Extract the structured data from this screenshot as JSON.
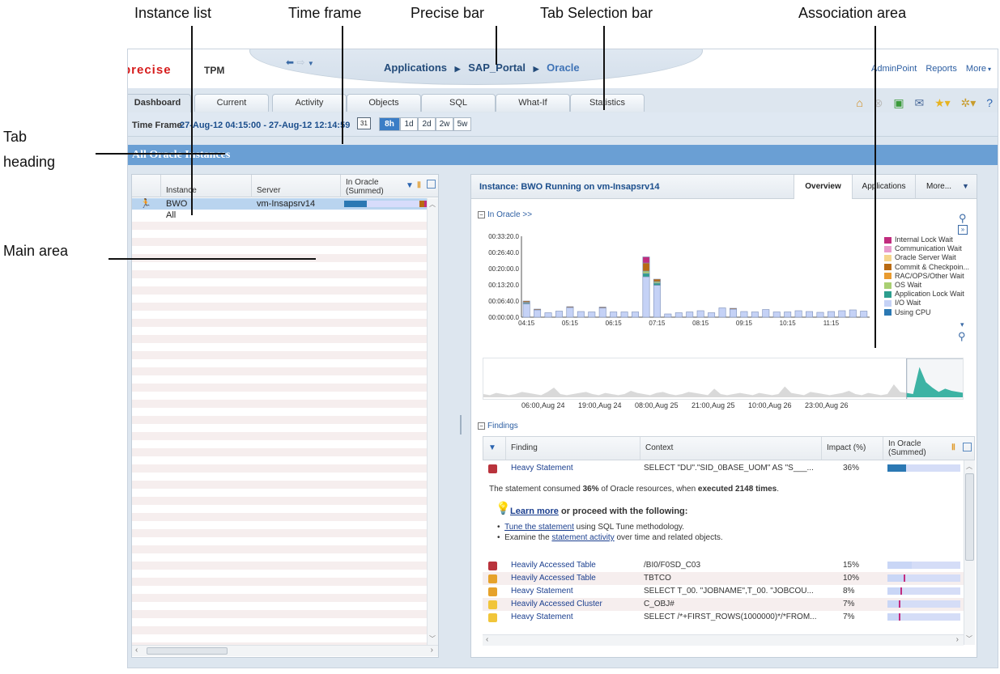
{
  "callouts": {
    "instance_list": "Instance list",
    "time_frame": "Time frame",
    "precise_bar": "Precise bar",
    "tab_selection_bar": "Tab Selection bar",
    "association_area": "Association area",
    "tab_heading_line1": "Tab",
    "tab_heading_line2": "heading",
    "main_area": "Main area"
  },
  "app": {
    "logo": "precise",
    "product": "TPM",
    "breadcrumb": {
      "applications": "Applications",
      "sap_portal": "SAP_Portal",
      "current": "Oracle"
    },
    "toplinks": {
      "adminpoint": "AdminPoint",
      "reports": "Reports",
      "more": "More"
    },
    "tabs": [
      "Dashboard",
      "Current",
      "Activity",
      "Objects",
      "SQL",
      "What-If",
      "Statistics"
    ],
    "active_tab": "Dashboard",
    "toolbar_icons": [
      "home-icon",
      "stop-icon",
      "save-icon",
      "mail-icon",
      "star-icon",
      "gear-icon",
      "help-icon"
    ]
  },
  "timeframe": {
    "label": "Time Frame:",
    "value": "27-Aug-12 04:15:00 - 27-Aug-12 12:14:59",
    "calendar": "31",
    "buttons": [
      "8h",
      "1d",
      "2d",
      "2w",
      "5w"
    ],
    "active": "8h"
  },
  "heading": "All Oracle Instances",
  "instance_table": {
    "headers": {
      "instance": "Instance",
      "server": "Server",
      "inoracle": "In Oracle (Summed)"
    },
    "rows": [
      {
        "instance": "BWO",
        "server": "vm-Insapsrv14"
      },
      {
        "instance": "All",
        "server": ""
      }
    ]
  },
  "association": {
    "title": "Instance: BWO Running on vm-Insapsrv14",
    "tabs": {
      "overview": "Overview",
      "applications": "Applications",
      "more": "More..."
    },
    "inoracle_label": "In Oracle >>",
    "findings_label": "Findings"
  },
  "chart_data": [
    {
      "type": "bar",
      "title": "",
      "categories": [
        "04:15",
        "04:30",
        "04:45",
        "05:00",
        "05:15",
        "05:30",
        "05:45",
        "06:00",
        "06:15",
        "06:30",
        "06:45",
        "07:00",
        "07:15",
        "07:30",
        "07:45",
        "08:00",
        "08:15",
        "08:30",
        "08:45",
        "09:00",
        "09:15",
        "09:30",
        "09:45",
        "10:00",
        "10:15",
        "10:30",
        "10:45",
        "11:00",
        "11:15",
        "11:30",
        "11:45",
        "12:00"
      ],
      "ytick_labels": [
        "00:00:00.0",
        "00:06:40.0",
        "00:13:20.0",
        "00:20:00.0",
        "00:26:40.0",
        "00:33:20.0"
      ],
      "xtick_labels": [
        "04:15",
        "05:15",
        "06:15",
        "07:15",
        "08:15",
        "09:15",
        "10:15",
        "11:15"
      ],
      "ylim_seconds": [
        0,
        2000
      ],
      "series": [
        {
          "name": "I/O Wait",
          "values": [
            330,
            180,
            110,
            150,
            240,
            140,
            130,
            230,
            130,
            130,
            130,
            1000,
            790,
            80,
            110,
            130,
            160,
            110,
            230,
            200,
            140,
            130,
            190,
            130,
            130,
            160,
            140,
            120,
            140,
            160,
            180,
            150
          ]
        },
        {
          "name": "Application Lock Wait",
          "values": [
            20,
            0,
            0,
            0,
            0,
            0,
            0,
            0,
            0,
            0,
            0,
            80,
            50,
            0,
            0,
            0,
            0,
            0,
            0,
            0,
            0,
            0,
            0,
            0,
            0,
            0,
            0,
            0,
            0,
            0,
            0,
            0
          ]
        },
        {
          "name": "OS Wait",
          "values": [
            20,
            0,
            0,
            0,
            0,
            0,
            0,
            0,
            0,
            0,
            0,
            60,
            40,
            0,
            0,
            0,
            0,
            0,
            0,
            0,
            0,
            0,
            0,
            0,
            0,
            0,
            0,
            0,
            0,
            0,
            0,
            0
          ]
        },
        {
          "name": "Commit & Checkpoin...",
          "values": [
            30,
            20,
            0,
            0,
            20,
            0,
            0,
            20,
            0,
            0,
            0,
            200,
            60,
            0,
            0,
            0,
            0,
            0,
            0,
            20,
            0,
            0,
            0,
            0,
            0,
            0,
            0,
            0,
            0,
            0,
            0,
            0
          ]
        },
        {
          "name": "Internal Lock Wait",
          "values": [
            0,
            0,
            0,
            0,
            0,
            0,
            0,
            0,
            0,
            0,
            0,
            150,
            0,
            0,
            0,
            0,
            0,
            0,
            0,
            0,
            0,
            0,
            0,
            0,
            0,
            0,
            0,
            0,
            0,
            0,
            0,
            0
          ]
        },
        {
          "name": "Oracle Server Wait",
          "values": [
            0,
            0,
            0,
            0,
            0,
            0,
            0,
            0,
            0,
            0,
            0,
            0,
            0,
            0,
            0,
            0,
            0,
            0,
            0,
            0,
            0,
            0,
            0,
            0,
            0,
            0,
            0,
            0,
            0,
            0,
            0,
            0
          ]
        },
        {
          "name": "Communication Wait",
          "values": [
            0,
            0,
            0,
            0,
            0,
            0,
            0,
            0,
            0,
            0,
            0,
            0,
            0,
            0,
            0,
            0,
            0,
            0,
            0,
            0,
            0,
            0,
            0,
            0,
            0,
            0,
            0,
            0,
            0,
            0,
            0,
            0
          ]
        },
        {
          "name": "RAC/OPS/Other Wait",
          "values": [
            0,
            0,
            0,
            0,
            0,
            0,
            0,
            0,
            0,
            0,
            0,
            0,
            0,
            0,
            0,
            0,
            0,
            0,
            0,
            0,
            0,
            0,
            0,
            0,
            0,
            0,
            0,
            0,
            0,
            0,
            0,
            0
          ]
        },
        {
          "name": "Using CPU",
          "values": [
            0,
            0,
            0,
            0,
            0,
            0,
            0,
            0,
            0,
            0,
            0,
            0,
            0,
            0,
            0,
            0,
            0,
            0,
            0,
            0,
            0,
            0,
            0,
            0,
            0,
            0,
            0,
            0,
            0,
            0,
            0,
            0
          ]
        }
      ],
      "legend": [
        "Internal Lock Wait",
        "Communication Wait",
        "Oracle Server Wait",
        "Commit & Checkpoin...",
        "RAC/OPS/Other Wait",
        "OS Wait",
        "Application Lock Wait",
        "I/O Wait",
        "Using CPU"
      ],
      "colors": [
        "#c12c7e",
        "#e89ccc",
        "#f5d58c",
        "#b86a12",
        "#e99b2f",
        "#a9cf72",
        "#2d9e8e",
        "#c5d2f6",
        "#2b78b3"
      ]
    },
    {
      "type": "area",
      "title": "",
      "xtick_labels": [
        "06:00,Aug 24",
        "19:00,Aug 24",
        "08:00,Aug 25",
        "21:00,Aug 25",
        "10:00,Aug 26",
        "23:00,Aug 26"
      ],
      "values": [
        3,
        2,
        4,
        3,
        2,
        3,
        5,
        4,
        3,
        2,
        5,
        9,
        3,
        2,
        3,
        4,
        5,
        3,
        2,
        4,
        3,
        2,
        3,
        6,
        4,
        3,
        2,
        4,
        5,
        3,
        2,
        3,
        5,
        4,
        3,
        2,
        8,
        3,
        2,
        3,
        4,
        3,
        2,
        4,
        3,
        2,
        3,
        10,
        4,
        3,
        2,
        5,
        4,
        3,
        2,
        3,
        4,
        6,
        3,
        2,
        4,
        3,
        2,
        3,
        12,
        5,
        4,
        3,
        28,
        14,
        9,
        5,
        8,
        6,
        5,
        4
      ],
      "color": "#d9d9d9",
      "highlight_color": "#3db3a4"
    }
  ],
  "findings_table": {
    "headers": {
      "finding": "Finding",
      "context": "Context",
      "impact": "Impact (%)",
      "inoracle": "In Oracle (Summed)"
    },
    "rows": [
      {
        "finding": "Heavy Statement",
        "context": "SELECT \"DU\".\"SID_0BASE_UOM\" AS \"S___...",
        "impact": "36%",
        "severity": "red",
        "bar": 0.36
      },
      {
        "finding": "Heavily Accessed Table",
        "context": "/BI0/F0SD_C03",
        "impact": "15%",
        "severity": "red",
        "bar": 0.15
      },
      {
        "finding": "Heavily Accessed Table",
        "context": "TBTCO",
        "impact": "10%",
        "severity": "orange",
        "bar": 0.1
      },
      {
        "finding": "Heavy Statement",
        "context": "SELECT T_00. \"JOBNAME\",T_00. \"JOBCOU...",
        "impact": "8%",
        "severity": "orange",
        "bar": 0.08
      },
      {
        "finding": "Heavily Accessed Cluster",
        "context": "C_OBJ#",
        "impact": "7%",
        "severity": "yellow",
        "bar": 0.07
      },
      {
        "finding": "Heavy Statement",
        "context": "SELECT /*+FIRST_ROWS(1000000)*/*FROM...",
        "impact": "7%",
        "severity": "yellow",
        "bar": 0.07
      }
    ],
    "detail": {
      "sentence_pre": "The statement consumed ",
      "sentence_pct": "36%",
      "sentence_mid": " of Oracle resources, when ",
      "sentence_exec": "executed 2148 times",
      "sentence_end": ".",
      "learn_more": "Learn more",
      "learn_rest": " or proceed with the following:",
      "bullet1_link": "Tune the statement",
      "bullet1_rest": " using SQL Tune methodology.",
      "bullet2_pre": "Examine the ",
      "bullet2_link": "statement activity",
      "bullet2_rest": " over time and related objects."
    }
  }
}
